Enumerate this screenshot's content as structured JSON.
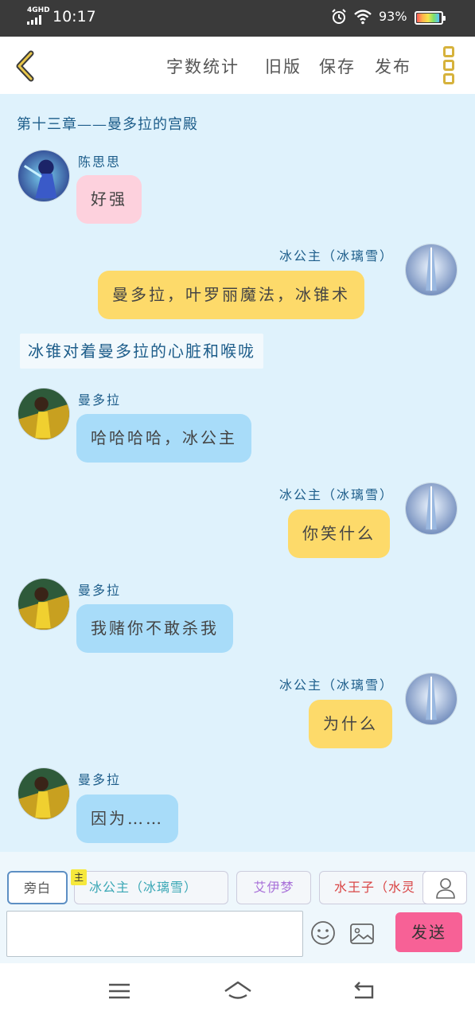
{
  "status_bar": {
    "network": "4GHD",
    "time": "10:17",
    "battery_text": "93%",
    "battery_level": 0.93
  },
  "topbar": {
    "actions": [
      "字数统计",
      "旧版",
      "保存",
      "发布"
    ]
  },
  "chapter": {
    "title": "第十三章——曼多拉的宫殿"
  },
  "messages": [
    {
      "side": "left",
      "name": "陈思思",
      "text": "好强",
      "color": "#fdd1dd"
    },
    {
      "side": "right",
      "name": "冰公主（冰璃雪）",
      "text": "曼多拉，叶罗丽魔法，冰锥术",
      "color": "#fdda6a"
    },
    {
      "side": "narration",
      "text": "冰锥对着曼多拉的心脏和喉咙"
    },
    {
      "side": "left",
      "name": "曼多拉",
      "text": "哈哈哈哈，冰公主",
      "color": "#a8dcf9"
    },
    {
      "side": "right",
      "name": "冰公主（冰璃雪）",
      "text": "你笑什么",
      "color": "#fdda6a"
    },
    {
      "side": "left",
      "name": "曼多拉",
      "text": "我赌你不敢杀我",
      "color": "#a8dcf9"
    },
    {
      "side": "right",
      "name": "冰公主（冰璃雪）",
      "text": "为什么",
      "color": "#fdda6a"
    },
    {
      "side": "left",
      "name": "曼多拉",
      "text": "因为……",
      "color": "#a8dcf9"
    }
  ],
  "toolbar": {
    "narrator_label": "旁白",
    "main_tag": "主",
    "characters": [
      "冰公主（冰璃雪）",
      "艾伊梦",
      "水王子（水灵"
    ],
    "input_placeholder": "",
    "send_label": "发送"
  },
  "colors": {
    "chat_background": "#dff2fc",
    "accent_text": "#1d5d8a",
    "send_button": "#f76196"
  }
}
